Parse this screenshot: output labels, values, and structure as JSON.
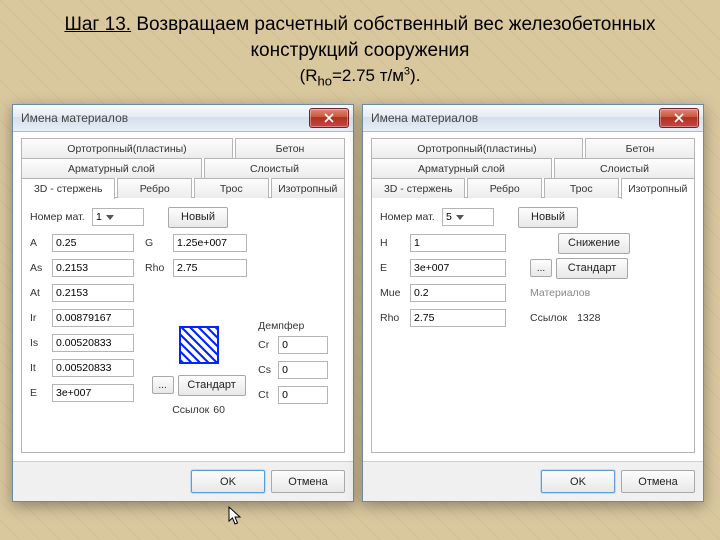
{
  "caption": {
    "step_underline": "Шаг 13.",
    "line1_rest": " Возвращаем расчетный собственный вес железобетонных конструкций сооружения",
    "formula_pre": "(R",
    "formula_sub": "ho",
    "formula_mid": "=2.75 т/м",
    "formula_sup": "3",
    "formula_post": ")."
  },
  "left": {
    "title": "Имена материалов",
    "tabs": {
      "r1": [
        "Ортотропный(пластины)",
        "Бетон"
      ],
      "r2": [
        "Арматурный слой",
        "Слоистый"
      ],
      "r3": [
        "3D - стержень",
        "Ребро",
        "Трос",
        "Изотропный"
      ],
      "active": "3D - стержень"
    },
    "mat_label": "Номер мат.",
    "mat_value": "1",
    "new_btn": "Новый",
    "fieldsA": [
      {
        "k": "A",
        "v": "0.25"
      },
      {
        "k": "As",
        "v": "0.2153"
      },
      {
        "k": "At",
        "v": "0.2153"
      },
      {
        "k": "Ir",
        "v": "0.00879167"
      },
      {
        "k": "Is",
        "v": "0.00520833"
      },
      {
        "k": "It",
        "v": "0.00520833"
      },
      {
        "k": "E",
        "v": "3e+007"
      }
    ],
    "fieldsB": [
      {
        "k": "G",
        "v": "1.25e+007"
      },
      {
        "k": "Rho",
        "v": "2.75"
      }
    ],
    "std_btn": "Стандарт",
    "dots_btn": "...",
    "links_label": "Ссылок",
    "links_value": "60",
    "damper_label": "Демпфер",
    "damper": [
      {
        "k": "Cr",
        "v": "0"
      },
      {
        "k": "Cs",
        "v": "0"
      },
      {
        "k": "Ct",
        "v": "0"
      }
    ],
    "ok": "OK",
    "cancel": "Отмена"
  },
  "right": {
    "title": "Имена материалов",
    "tabs": {
      "r1": [
        "Ортотропный(пластины)",
        "Бетон"
      ],
      "r2": [
        "Арматурный слой",
        "Слоистый"
      ],
      "r3": [
        "3D - стержень",
        "Ребро",
        "Трос",
        "Изотропный"
      ],
      "active": "Изотропный"
    },
    "mat_label": "Номер мат.",
    "mat_value": "5",
    "new_btn": "Новый",
    "fields": [
      {
        "k": "H",
        "v": "1"
      },
      {
        "k": "E",
        "v": "3e+007"
      },
      {
        "k": "Mue",
        "v": "0.2"
      },
      {
        "k": "Rho",
        "v": "2.75"
      }
    ],
    "reduce_btn": "Снижение",
    "std_btn": "Стандарт",
    "dots_btn": "...",
    "mat_grey": "Материалов",
    "links_label": "Ссылок",
    "links_value": "1328",
    "ok": "OK",
    "cancel": "Отмена"
  }
}
